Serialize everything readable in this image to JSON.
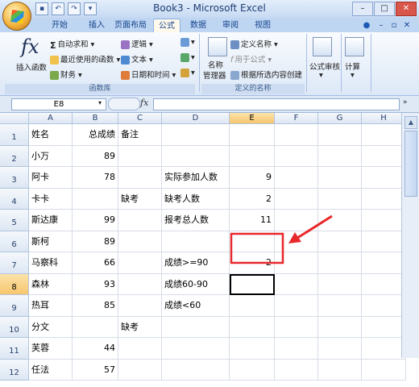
{
  "window": {
    "title": "Book3 - Microsoft Excel"
  },
  "ribbon_tabs": [
    "开始",
    "插入",
    "页面布局",
    "公式",
    "数据",
    "审阅",
    "视图"
  ],
  "active_tab": "公式",
  "ribbon": {
    "insert_function": "插入函数",
    "autosum": "自动求和",
    "recently_used": "最近使用的函数",
    "financial": "财务",
    "logical": "逻辑",
    "text": "文本",
    "datetime": "日期和时间",
    "function_library_label": "函数库",
    "name_manager_1": "名称",
    "name_manager_2": "管理器",
    "define_name": "定义名称",
    "use_in_formula": "用于公式",
    "create_from_selection": "根据所选内容创建",
    "defined_names_label": "定义的名称",
    "formula_auditing": "公式审核",
    "calculation": "计算"
  },
  "formula_bar": {
    "name_box": "E8",
    "fx": "fx",
    "value": ""
  },
  "columns": [
    "A",
    "B",
    "C",
    "D",
    "E",
    "F",
    "G",
    "H"
  ],
  "selected_column": "E",
  "selected_row": "8",
  "rows": [
    {
      "n": "1",
      "cells": [
        "姓名",
        "总成绩",
        "备注",
        "",
        "",
        "",
        "",
        ""
      ]
    },
    {
      "n": "2",
      "cells": [
        "小万",
        "89",
        "",
        "",
        "",
        "",
        "",
        ""
      ]
    },
    {
      "n": "3",
      "cells": [
        "阿卡",
        "78",
        "",
        "实际参加人数",
        "9",
        "",
        "",
        ""
      ]
    },
    {
      "n": "4",
      "cells": [
        "卡卡",
        "",
        "缺考",
        "缺考人数",
        "2",
        "",
        "",
        ""
      ]
    },
    {
      "n": "5",
      "cells": [
        "斯达康",
        "99",
        "",
        "报考总人数",
        "11",
        "",
        "",
        ""
      ]
    },
    {
      "n": "6",
      "cells": [
        "斯柯",
        "89",
        "",
        "",
        "",
        "",
        "",
        ""
      ]
    },
    {
      "n": "7",
      "cells": [
        "马察科",
        "66",
        "",
        "成绩>=90",
        "2",
        "",
        "",
        ""
      ]
    },
    {
      "n": "8",
      "cells": [
        "森林",
        "93",
        "",
        "成绩60-90",
        "",
        "",
        "",
        ""
      ]
    },
    {
      "n": "9",
      "cells": [
        "热耳",
        "85",
        "",
        "成绩<60",
        "",
        "",
        "",
        ""
      ]
    },
    {
      "n": "10",
      "cells": [
        "分文",
        "",
        "缺考",
        "",
        "",
        "",
        "",
        ""
      ]
    },
    {
      "n": "11",
      "cells": [
        "芙蓉",
        "44",
        "",
        "",
        "",
        "",
        "",
        ""
      ]
    },
    {
      "n": "12",
      "cells": [
        "任法",
        "57",
        "",
        "",
        "",
        "",
        "",
        ""
      ]
    }
  ],
  "colors": {
    "annotation_red": "#e8282b",
    "selection_border": "#000000"
  }
}
